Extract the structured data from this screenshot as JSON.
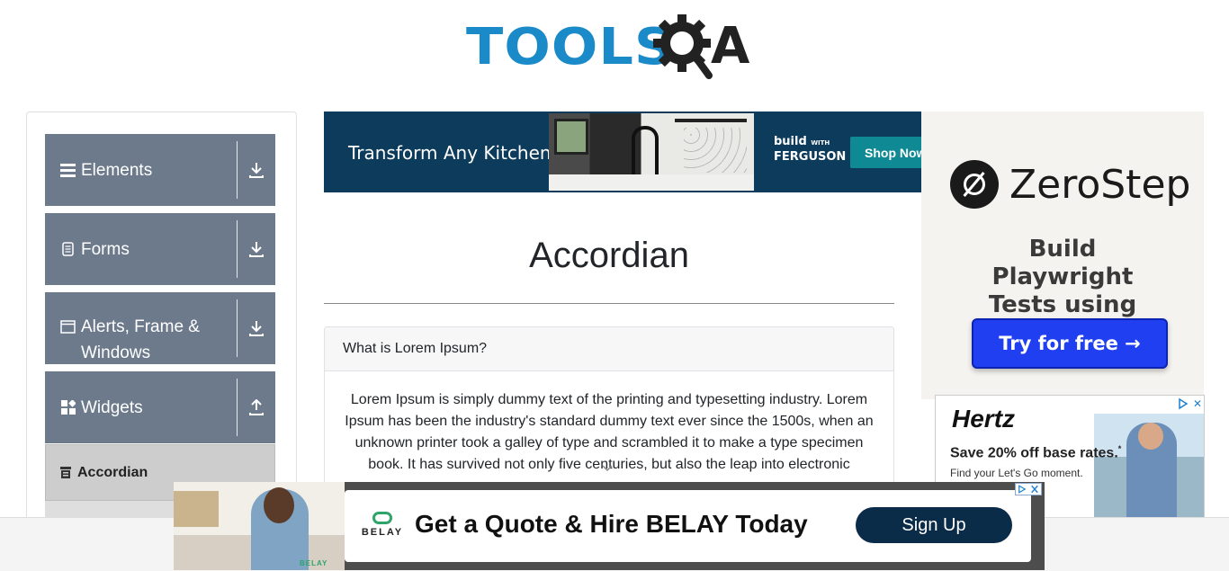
{
  "header": {
    "logo_text": "TOOLS",
    "logo_suffix": "A"
  },
  "sidebar": {
    "groups": [
      {
        "label": "Elements",
        "icon": "menu-icon",
        "toggle_icon": "download-icon"
      },
      {
        "label": "Forms",
        "icon": "document-icon",
        "toggle_icon": "download-icon"
      },
      {
        "label": "Alerts, Frame & Windows",
        "icon": "window-icon",
        "toggle_icon": "download-icon"
      },
      {
        "label": "Widgets",
        "icon": "widgets-icon",
        "toggle_icon": "upload-icon"
      }
    ],
    "active_item": {
      "label": "Accordian",
      "icon": "accordion-icon"
    }
  },
  "top_ad": {
    "headline": "Transform Any Kitchen",
    "brand_line1": "build",
    "brand_line2": "FERGUSON",
    "brand_with": "WITH",
    "button": "Shop Now"
  },
  "main": {
    "title": "Accordian",
    "section_header": "What is Lorem Ipsum?",
    "section_body": "Lorem Ipsum is simply dummy text of the printing and typesetting industry. Lorem Ipsum has been the industry's standard dummy text ever since the 1500s, when an unknown printer took a galley of type and scrambled it to make a type specimen book. It has survived not only five centuries, but also the leap into electronic"
  },
  "right_ad": {
    "brand": "ZeroStep",
    "tagline": "Build Playwright Tests using AI",
    "button": "Try for free →"
  },
  "hertz_ad": {
    "brand": "Hertz",
    "offer": "Save 20% off base rates.",
    "offer_mark": "*",
    "subtext": "Find your Let's Go moment.",
    "close": "✕"
  },
  "bottom_ad": {
    "brand": "BELAY",
    "headline": "Get a Quote & Hire BELAY Today",
    "button": "Sign Up",
    "footer_brand": "BELAY"
  },
  "colors": {
    "logo_blue": "#1b8ac8",
    "sidebar_group_bg": "#6d7a8c",
    "zerostep_button": "#1f3ff0",
    "belay_button": "#0b2c48"
  }
}
